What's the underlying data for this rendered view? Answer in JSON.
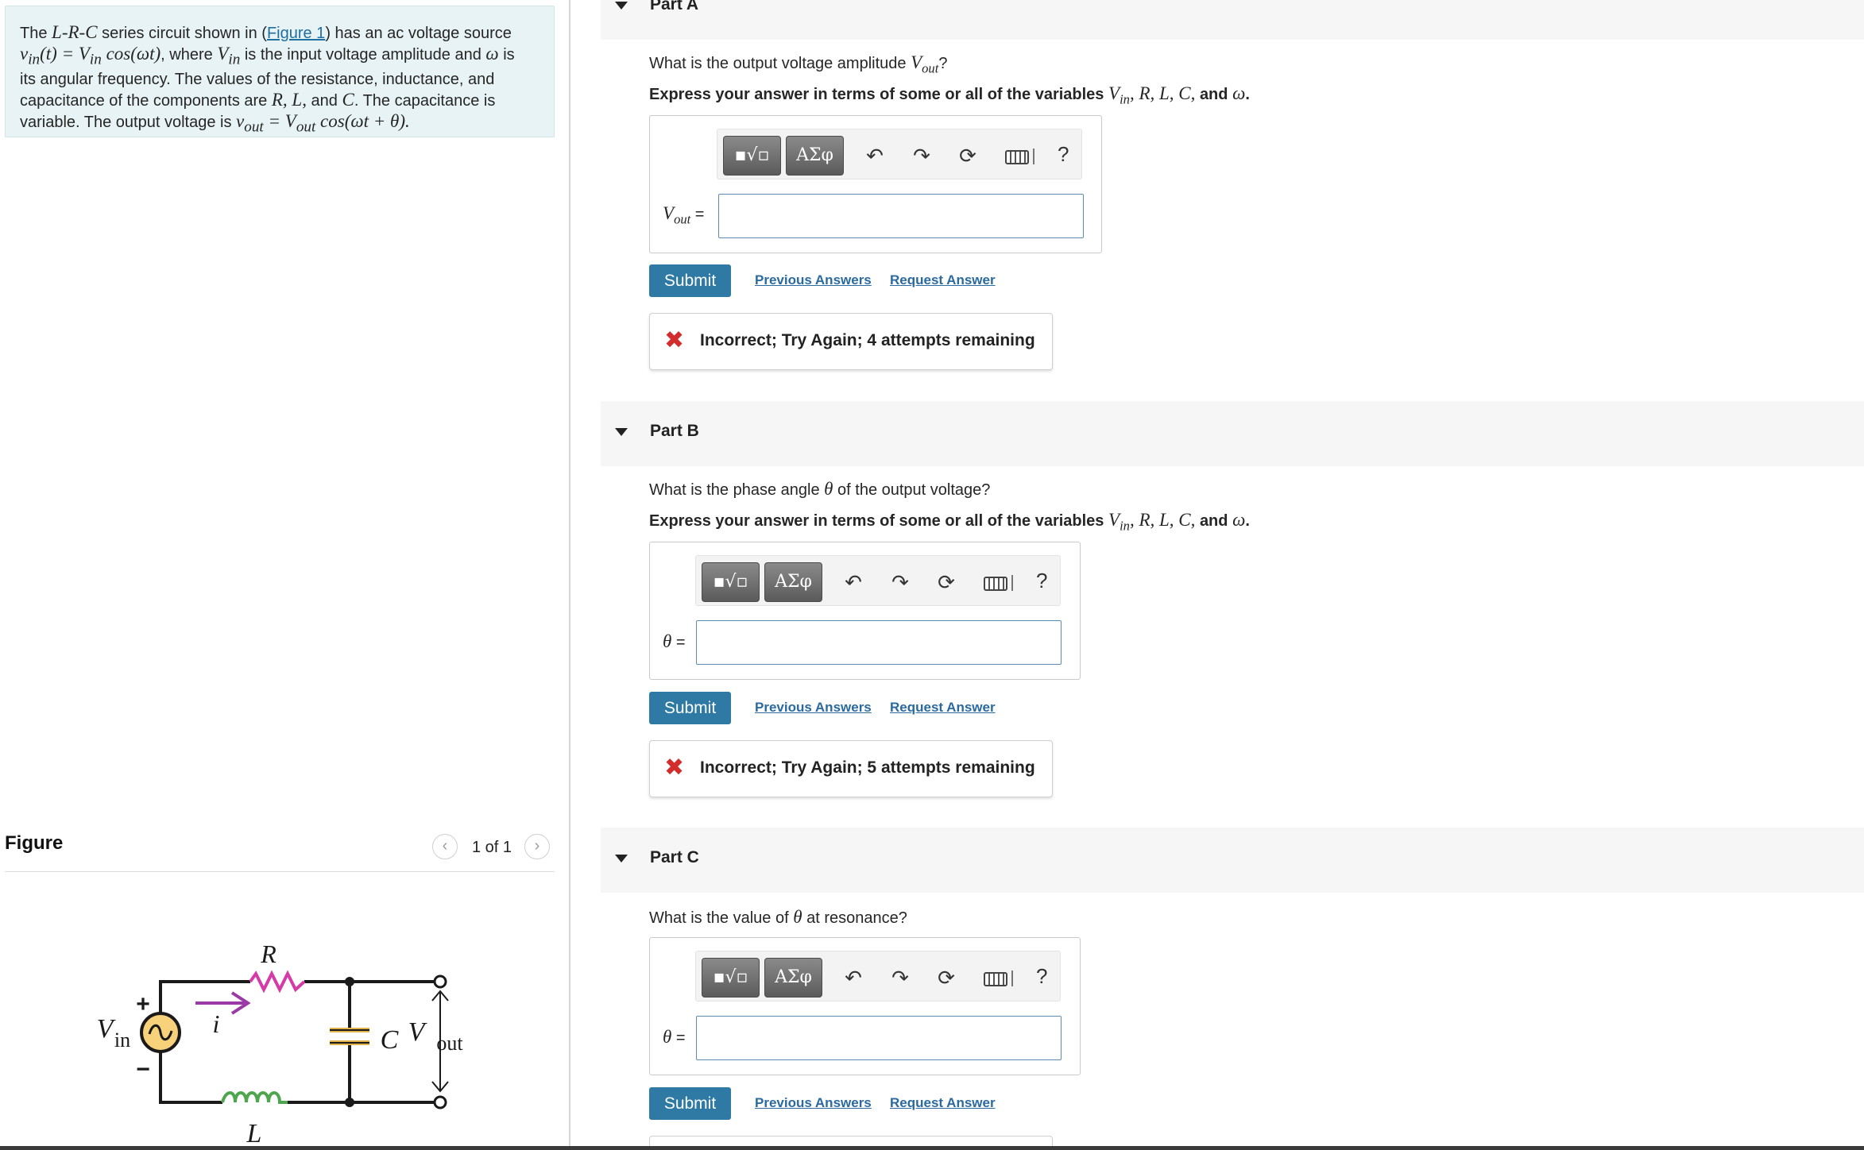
{
  "problem": {
    "intro_the": "The",
    "intro_lrc": "L-R-C",
    "intro_series": "series circuit shown in (",
    "figure_link": "Figure 1",
    "intro_has": ") has an ac voltage source",
    "vin_expr": "v",
    "vin_expr_sub": "in",
    "vin_expr_rest": "(t) = V",
    "vin_expr_sub2": "in",
    "vin_expr_cos": "cos(ωt)",
    "intro_where": ", where",
    "vin_amp": "V",
    "vin_amp_sub": "in",
    "intro_is_input": "is the input voltage amplitude and",
    "omega": "ω",
    "intro_is": "is",
    "intro_line3": "its angular frequency. The values of the resistance, inductance, and",
    "intro_line4a": "capacitance of the components are",
    "var_rlc": "R, L,",
    "intro_and": "and",
    "var_c": "C",
    "intro_line4b": ". The capacitance is",
    "intro_line5": "variable. The output voltage is",
    "vout_expr": "v",
    "vout_expr_sub": "out",
    "vout_expr_eq": "= V",
    "vout_expr_sub2": "out",
    "vout_expr_cos": "cos(ωt + θ)."
  },
  "figure": {
    "title": "Figure",
    "pager_text": "1 of 1",
    "prev_icon": "chevron-left",
    "next_icon": "chevron-right",
    "labels": {
      "R": "R",
      "i": "i",
      "C": "C",
      "L": "L",
      "Vin_V": "V",
      "Vin_sub": "in",
      "Vout_V": "V",
      "Vout_sub": "out",
      "plus": "+",
      "minus": "−"
    },
    "colors": {
      "wire": "#1a1a1a",
      "resistor": "#d63aa6",
      "inductor": "#4fa64f",
      "capacitor": "#e4b24a",
      "arrow": "#9b3aa6",
      "source_fill": "#f7d27a"
    }
  },
  "parts": [
    {
      "label": "Part A",
      "question_pre": "What is the output voltage amplitude",
      "question_var": "V",
      "question_sub": "out",
      "question_post": "?",
      "instruction_pre": "Express your answer in terms of some or all of the variables",
      "instruction_vars": "V",
      "instruction_sub": "in",
      "instruction_vars2": ", R, L, C,",
      "instruction_and": "and",
      "instruction_omega": "ω",
      "instruction_end": ".",
      "var_label": "V",
      "var_sub": "out",
      "var_eq": "=",
      "input_value": "",
      "submit": "Submit",
      "previous_answers": "Previous Answers",
      "request_answer": "Request Answer",
      "feedback": "Incorrect; Try Again; 4 attempts remaining"
    },
    {
      "label": "Part B",
      "question_pre": "What is the phase angle",
      "question_var": "θ",
      "question_post": "of the output voltage?",
      "instruction_pre": "Express your answer in terms of some or all of the variables",
      "instruction_vars": "V",
      "instruction_sub": "in",
      "instruction_vars2": ", R, L, C,",
      "instruction_and": "and",
      "instruction_omega": "ω",
      "instruction_end": ".",
      "var_label": "θ",
      "var_eq": "=",
      "input_value": "",
      "submit": "Submit",
      "previous_answers": "Previous Answers",
      "request_answer": "Request Answer",
      "feedback": "Incorrect; Try Again; 5 attempts remaining"
    },
    {
      "label": "Part C",
      "question_pre": "What is the value of",
      "question_var": "θ",
      "question_post": "at resonance?",
      "var_label": "θ",
      "var_eq": "=",
      "input_value": "",
      "submit": "Submit",
      "previous_answers": "Previous Answers",
      "request_answer": "Request Answer"
    }
  ],
  "toolbar": {
    "templates_icon": "fraction-sqrt-template-icon",
    "greek_label": "ΑΣφ",
    "undo_icon": "undo-icon",
    "redo_icon": "redo-icon",
    "reset_icon": "reset-icon",
    "keyboard_icon": "keyboard-icon",
    "help_label": "?"
  },
  "colors": {
    "accent": "#2e7aa5",
    "link": "#2a6aa0",
    "intro_bg": "#e7f3f5",
    "error": "#d22c2c",
    "part_bar": "#f6f6f6"
  }
}
